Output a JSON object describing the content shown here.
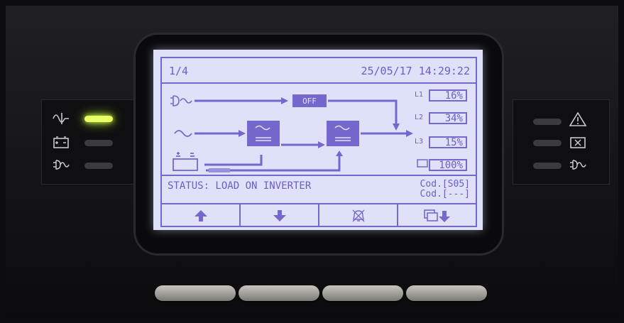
{
  "header": {
    "page": "1/4",
    "datetime": "25/05/17 14:29:22"
  },
  "diagram": {
    "bypass_state": "OFF",
    "loads": [
      {
        "label": "L1",
        "value": "16%"
      },
      {
        "label": "L2",
        "value": "34%"
      },
      {
        "label": "L3",
        "value": "15%"
      }
    ],
    "battery_value": "100%"
  },
  "status": {
    "text": "STATUS: LOAD ON INVERTER",
    "code1": "Cod.[S05]",
    "code2": "Cod.[---]"
  },
  "softkeys": [
    "up-arrow-icon",
    "down-arrow-icon",
    "alarm-mute-icon",
    "pages-down-icon"
  ],
  "left_panel": [
    "ac-sine-icon",
    "battery-icon",
    "plug-bypass-icon"
  ],
  "right_panel": [
    "warning-triangle-icon",
    "battery-fault-icon",
    "bypass-fault-icon"
  ],
  "colors": {
    "lcd_bg": "#dee1f7",
    "lcd_ink": "#6b5ec7",
    "led_on": "#e8ff6a"
  }
}
